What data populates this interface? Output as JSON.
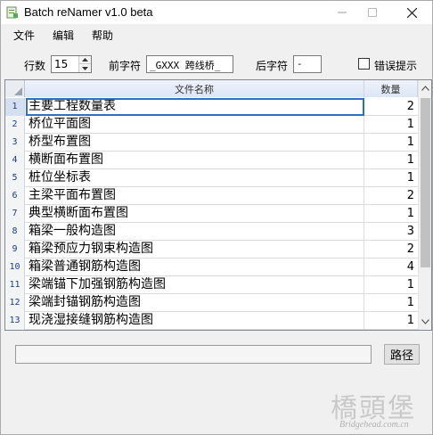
{
  "window": {
    "title": "Batch reNamer v1.0 beta"
  },
  "menu": {
    "items": [
      "文件",
      "编辑",
      "帮助"
    ]
  },
  "toolbar": {
    "rows_label": "行数",
    "rows_value": "15",
    "prefix_label": "前字符",
    "prefix_value": "_GXXX 跨线桥_",
    "suffix_label": "后字符",
    "suffix_value": "-",
    "error_hint_label": "错误提示",
    "error_hint_checked": false
  },
  "grid": {
    "headers": {
      "name": "文件名称",
      "qty": "数量"
    },
    "selected_row": 1,
    "rows": [
      {
        "num": "1",
        "name": "主要工程数量表",
        "qty": "2"
      },
      {
        "num": "2",
        "name": "桥位平面图",
        "qty": "1"
      },
      {
        "num": "3",
        "name": "桥型布置图",
        "qty": "1"
      },
      {
        "num": "4",
        "name": "横断面布置图",
        "qty": "1"
      },
      {
        "num": "5",
        "name": "桩位坐标表",
        "qty": "1"
      },
      {
        "num": "6",
        "name": "主梁平面布置图",
        "qty": "2"
      },
      {
        "num": "7",
        "name": "典型横断面布置图",
        "qty": "1"
      },
      {
        "num": "8",
        "name": "箱梁一般构造图",
        "qty": "3"
      },
      {
        "num": "9",
        "name": "箱梁预应力钢束构造图",
        "qty": "2"
      },
      {
        "num": "10",
        "name": "箱梁普通钢筋构造图",
        "qty": "4"
      },
      {
        "num": "11",
        "name": "梁端锚下加强钢筋构造图",
        "qty": "1"
      },
      {
        "num": "12",
        "name": "梁端封锚钢筋构造图",
        "qty": "1"
      },
      {
        "num": "13",
        "name": "现浇湿接缝钢筋构造图",
        "qty": "1"
      }
    ]
  },
  "path": {
    "value": "",
    "button_label": "路径"
  },
  "watermark": {
    "big": "橋頭堡",
    "small": "Bridgehead.com.cn"
  },
  "colors": {
    "selection": "#2f6fc6",
    "header_bg": "#dce6f5",
    "row_num_text": "#1a3d8c"
  }
}
